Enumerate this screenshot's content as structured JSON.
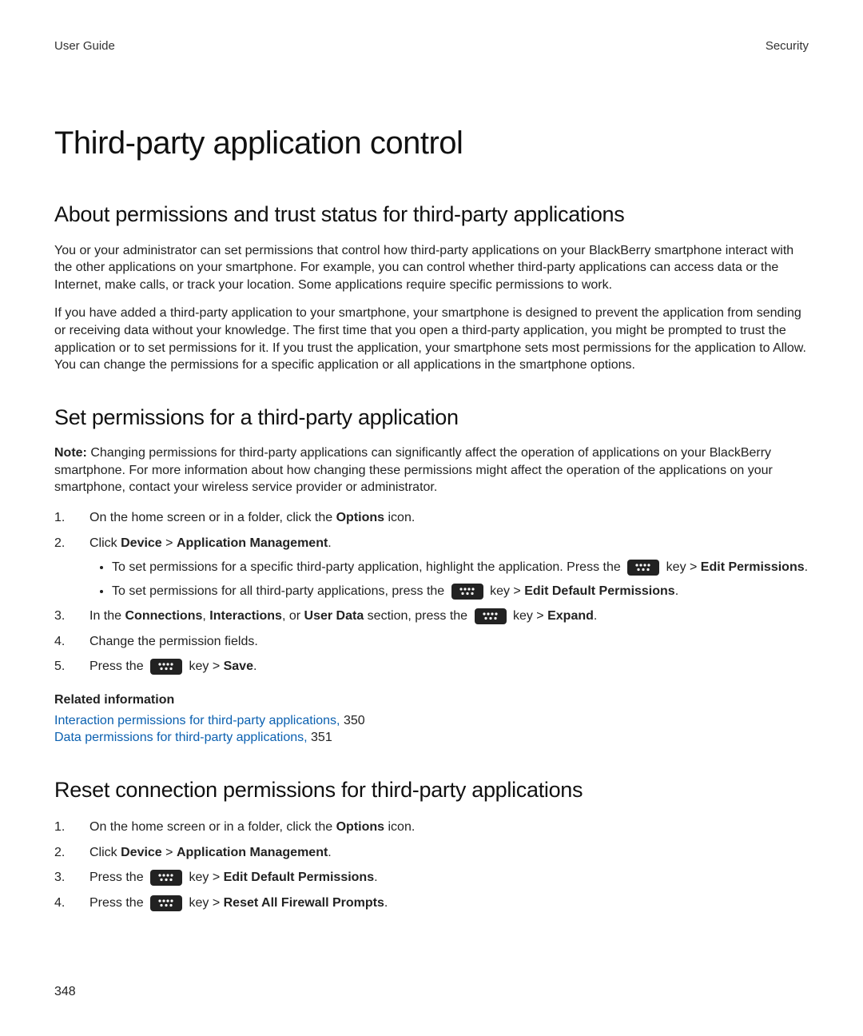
{
  "header": {
    "left": "User Guide",
    "right": "Security"
  },
  "page_title": "Third-party application control",
  "section_about": {
    "heading": "About permissions and trust status for third-party applications",
    "para1": "You or your administrator can set permissions that control how third-party applications on your BlackBerry smartphone interact with the other applications on your smartphone. For example, you can control whether third-party applications can access data or the Internet, make calls, or track your location. Some applications require specific permissions to work.",
    "para2": "If you have added a third-party application to your smartphone, your smartphone is designed to prevent the application from sending or receiving data without your knowledge. The first time that you open a third-party application, you might be prompted to trust the application or to set permissions for it. If you trust the application, your smartphone sets most permissions for the application to Allow. You can change the permissions for a specific application or all applications in the smartphone options."
  },
  "section_set": {
    "heading": "Set permissions for a third-party application",
    "note_label": "Note:",
    "note_body": " Changing permissions for third-party applications can significantly affect the operation of applications on your BlackBerry smartphone. For more information about how changing these permissions might affect the operation of the applications on your smartphone, contact your wireless service provider or administrator.",
    "step1_pre": "On the home screen or in a folder, click the ",
    "step1_bold": "Options",
    "step1_post": " icon.",
    "step2_pre": "Click ",
    "step2_b1": "Device",
    "step2_gt": " > ",
    "step2_b2": "Application Management",
    "step2_post": ".",
    "bullet1_pre": "To set permissions for a specific third-party application, highlight the application. Press the ",
    "bullet1_mid": " key > ",
    "bullet1_b1": "Edit Permissions",
    "bullet1_post": ".",
    "bullet2_pre": "To set permissions for all third-party applications, press the ",
    "bullet2_mid": " key > ",
    "bullet2_b1": "Edit Default Permissions",
    "bullet2_post": ".",
    "step3_pre": "In the ",
    "step3_b1": "Connections",
    "step3_c1": ", ",
    "step3_b2": "Interactions",
    "step3_c2": ", or ",
    "step3_b3": "User Data",
    "step3_mid": " section, press the ",
    "step3_key": " key > ",
    "step3_b4": "Expand",
    "step3_post": ".",
    "step4": "Change the permission fields.",
    "step5_pre": "Press the ",
    "step5_mid": " key > ",
    "step5_b1": "Save",
    "step5_post": "."
  },
  "related": {
    "heading": "Related information",
    "link1_text": "Interaction permissions for third-party applications,",
    "link1_page": " 350",
    "link2_text": "Data permissions for third-party applications,",
    "link2_page": " 351"
  },
  "section_reset": {
    "heading": "Reset connection permissions for third-party applications",
    "step1_pre": "On the home screen or in a folder, click the ",
    "step1_bold": "Options",
    "step1_post": " icon.",
    "step2_pre": "Click ",
    "step2_b1": "Device",
    "step2_gt": " > ",
    "step2_b2": "Application Management",
    "step2_post": ".",
    "step3_pre": "Press the ",
    "step3_mid": " key > ",
    "step3_b1": "Edit Default Permissions",
    "step3_post": ".",
    "step4_pre": "Press the ",
    "step4_mid": " key > ",
    "step4_b1": "Reset All Firewall Prompts",
    "step4_post": "."
  },
  "page_number": "348",
  "icons": {
    "menu_key": "blackberry-menu-key-icon"
  }
}
